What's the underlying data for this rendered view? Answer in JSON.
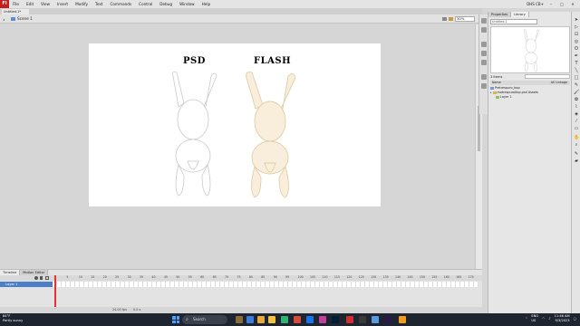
{
  "menubar": {
    "logo": "Fl",
    "items": [
      "File",
      "Edit",
      "View",
      "Insert",
      "Modify",
      "Text",
      "Commands",
      "Control",
      "Debug",
      "Window",
      "Help"
    ],
    "workspace": "DHS CB+",
    "minimize": "–",
    "maximize": "□",
    "close": "✕"
  },
  "document": {
    "tab": "Untitled-1*",
    "scene": "Scene 1",
    "back": "◂",
    "zoom": "30%"
  },
  "stage": {
    "label_left": "PSD",
    "label_right": "FLASH"
  },
  "timeline": {
    "tabs": [
      "Timeline",
      "Motion Editor"
    ],
    "layer_name": "Layer 1",
    "ticks": [
      "1",
      "5",
      "10",
      "15",
      "20",
      "25",
      "30",
      "35",
      "40",
      "45",
      "50",
      "55",
      "60",
      "65",
      "70",
      "75",
      "80",
      "85",
      "90",
      "95",
      "100",
      "105",
      "110",
      "115",
      "120",
      "125",
      "130",
      "135",
      "140",
      "145",
      "150",
      "155",
      "160",
      "165",
      "170"
    ],
    "fps": "24.00 fps",
    "time": "0.0 s"
  },
  "library": {
    "tabs": [
      "Properties",
      "Library"
    ],
    "doc_select": "Untitled-1",
    "count": "3 items",
    "columns": [
      "Name",
      "AS Linkage"
    ],
    "items": [
      {
        "name": "Pretrespuro_bop",
        "icon_color": "#7a9bd6"
      },
      {
        "name": "matrespuroltop.psd Assets",
        "icon_color": "#e0b44c"
      },
      {
        "name": "Layer 1",
        "icon_color": "#8cc25a"
      }
    ]
  },
  "taskbar": {
    "weather_temp": "84°F",
    "weather_desc": "Partly sunny",
    "search_placeholder": "Search",
    "lang": "ENG",
    "region": "US",
    "time": "11:46 AM",
    "date": "9/3/2023"
  },
  "colors": {
    "bear_fill": "#f8eedb",
    "bear_stroke": "#e0cfa6",
    "psd_stroke": "#c9c9c9",
    "accent_layer": "#4d7ec8",
    "playhead": "#e03333"
  }
}
